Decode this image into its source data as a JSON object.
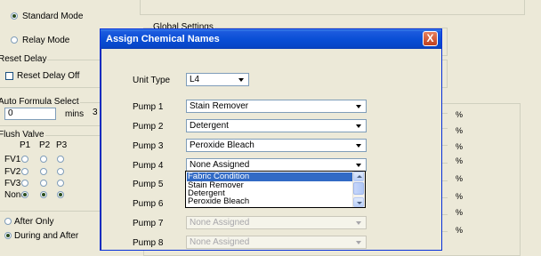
{
  "background": {
    "mode": {
      "standard_label": "Standard Mode",
      "relay_label": "Relay Mode",
      "selected": "standard"
    },
    "global_settings_label": "Global Settings",
    "reset_delay": {
      "group_label": "Reset Delay",
      "checkbox_label": "Reset Delay Off",
      "checked": false
    },
    "auto_formula": {
      "group_label": "Auto Formula Select",
      "value": "0",
      "unit": "mins",
      "partial_value": "3"
    },
    "flush_valve": {
      "group_label": "Flush Valve",
      "columns": [
        "P1",
        "P2",
        "P3"
      ],
      "rows": [
        "FV1",
        "FV2",
        "FV3",
        "None"
      ],
      "none_checked": [
        true,
        true,
        true
      ]
    },
    "timing": {
      "after_only_label": "After Only",
      "during_after_label": "During and After",
      "selected": "during_after"
    },
    "percent_sign": "%"
  },
  "dialog": {
    "title": "Assign Chemical Names",
    "close_label": "X",
    "unit_type": {
      "label": "Unit Type",
      "value": "L4"
    },
    "pumps": [
      {
        "label": "Pump 1",
        "value": "Stain Remover",
        "enabled": true
      },
      {
        "label": "Pump 2",
        "value": "Detergent",
        "enabled": true
      },
      {
        "label": "Pump 3",
        "value": "Peroxide Bleach",
        "enabled": true
      },
      {
        "label": "Pump 4",
        "value": "None Assigned",
        "enabled": true
      },
      {
        "label": "Pump 5",
        "value": "",
        "enabled": true
      },
      {
        "label": "Pump 6",
        "value": "",
        "enabled": true
      },
      {
        "label": "Pump 7",
        "value": "None Assigned",
        "enabled": false
      },
      {
        "label": "Pump 8",
        "value": "None Assigned",
        "enabled": false
      }
    ],
    "dropdown_options": [
      "Fabric Condition",
      "Stain Remover",
      "Detergent",
      "Peroxide Bleach"
    ],
    "dropdown_highlighted": "Fabric Condition"
  },
  "colors": {
    "title_bar": "#0a4fd6",
    "selection": "#316ac5",
    "window_bg": "#ece9d8"
  }
}
